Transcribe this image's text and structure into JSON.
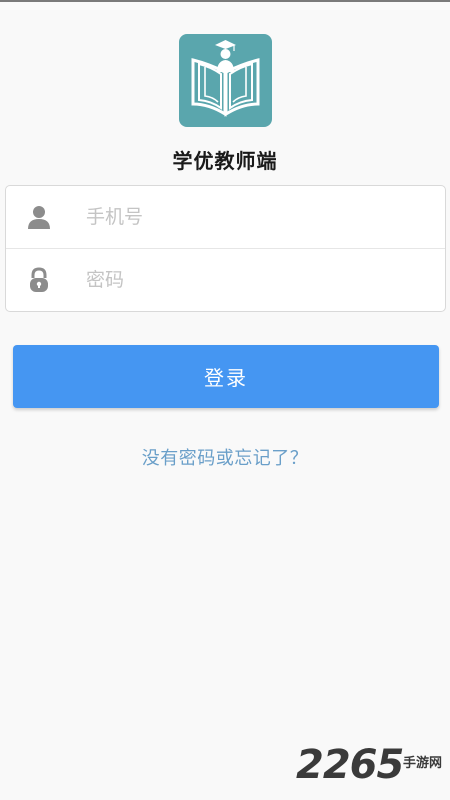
{
  "app": {
    "title": "学优教师端"
  },
  "form": {
    "phone_placeholder": "手机号",
    "password_placeholder": "密码"
  },
  "actions": {
    "login_label": "登录",
    "forgot_label": "没有密码或忘记了？"
  },
  "watermark": {
    "number": "2265",
    "text": "手游网"
  },
  "colors": {
    "background": "#f9f9f9",
    "logo": "#5aa6ad",
    "button": "#4596f2",
    "link": "#6a9fc9",
    "placeholder": "#c4c4c4"
  },
  "icons": {
    "logo": "book-graduate-logo-icon",
    "phone": "user-icon",
    "password": "lock-icon"
  }
}
